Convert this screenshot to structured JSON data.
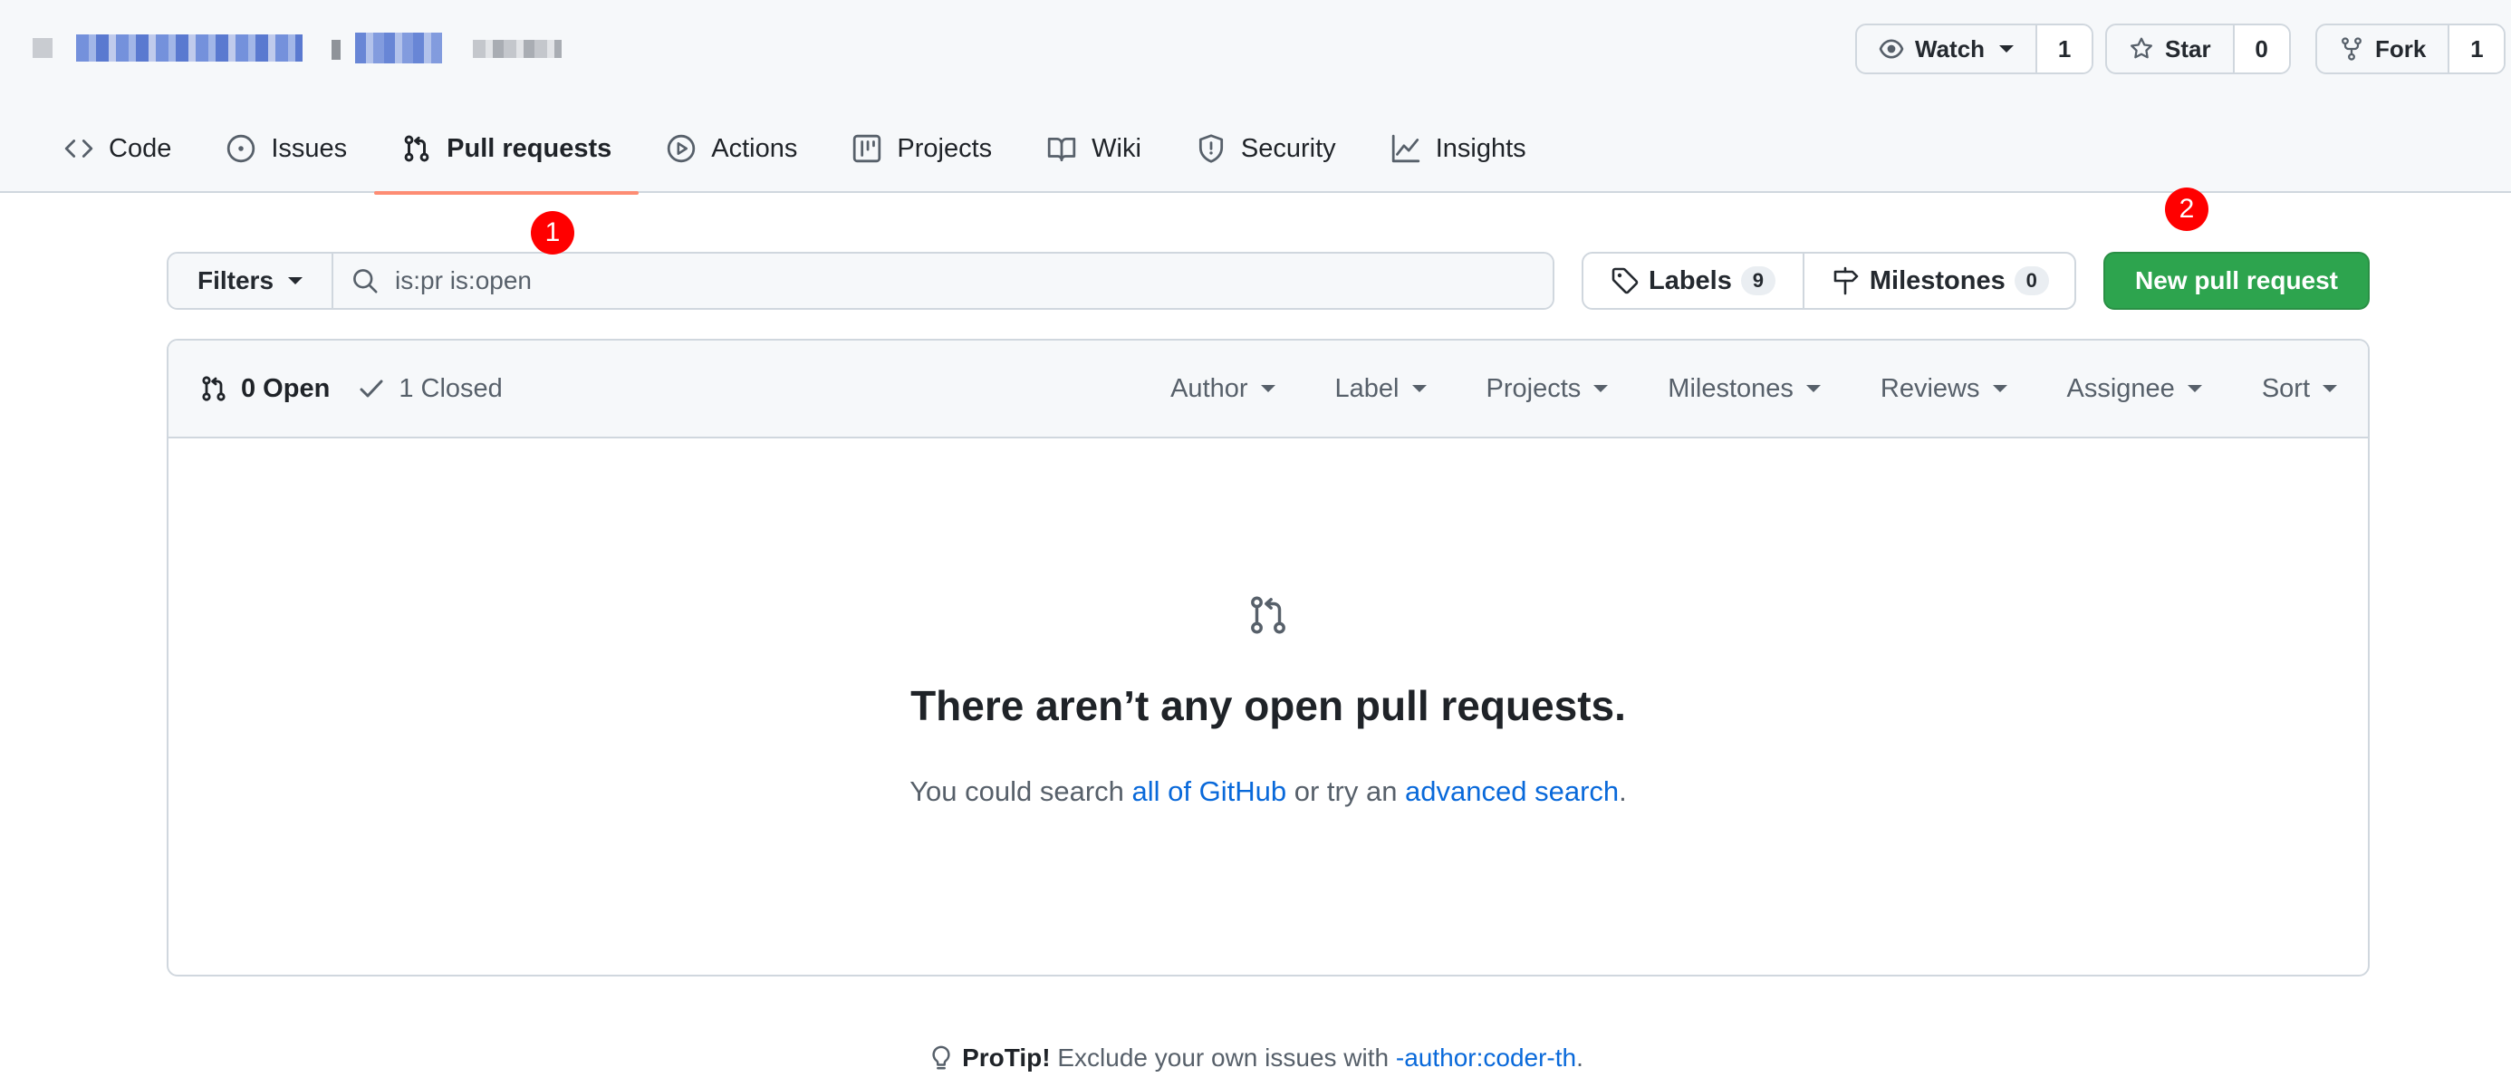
{
  "header": {
    "repo_name_blurred": "repository name (obscured)",
    "watch": {
      "label": "Watch",
      "count": "1"
    },
    "star": {
      "label": "Star",
      "count": "0"
    },
    "fork": {
      "label": "Fork",
      "count": "1"
    }
  },
  "nav": {
    "tabs": [
      {
        "label": "Code",
        "icon": "code-icon"
      },
      {
        "label": "Issues",
        "icon": "issue-opened-icon"
      },
      {
        "label": "Pull requests",
        "icon": "git-pull-request-icon",
        "active": true
      },
      {
        "label": "Actions",
        "icon": "play-icon"
      },
      {
        "label": "Projects",
        "icon": "table-icon"
      },
      {
        "label": "Wiki",
        "icon": "book-icon"
      },
      {
        "label": "Security",
        "icon": "shield-icon"
      },
      {
        "label": "Insights",
        "icon": "graph-icon"
      }
    ]
  },
  "toolbar": {
    "filters_label": "Filters",
    "search_value": "is:pr is:open",
    "labels": {
      "label": "Labels",
      "count": "9"
    },
    "milestones": {
      "label": "Milestones",
      "count": "0"
    },
    "new_pr_label": "New pull request"
  },
  "annotations": {
    "badge1": "1",
    "badge2": "2"
  },
  "list": {
    "open_label": "0 Open",
    "closed_label": "1 Closed",
    "filters": [
      "Author",
      "Label",
      "Projects",
      "Milestones",
      "Reviews",
      "Assignee",
      "Sort"
    ]
  },
  "blank": {
    "title": "There aren’t any open pull requests.",
    "desc_prefix": "You could search ",
    "link1": "all of GitHub",
    "desc_mid": " or try an ",
    "link2": "advanced search",
    "desc_suffix": "."
  },
  "protip": {
    "lead": "ProTip!",
    "text": " Exclude your own issues with ",
    "link": "-author:coder-th",
    "suffix": "."
  },
  "colors": {
    "primary_button": "#2da44e",
    "active_tab_underline": "#fd8c73",
    "link": "#0969da",
    "annotation_badge": "#ff0000"
  }
}
